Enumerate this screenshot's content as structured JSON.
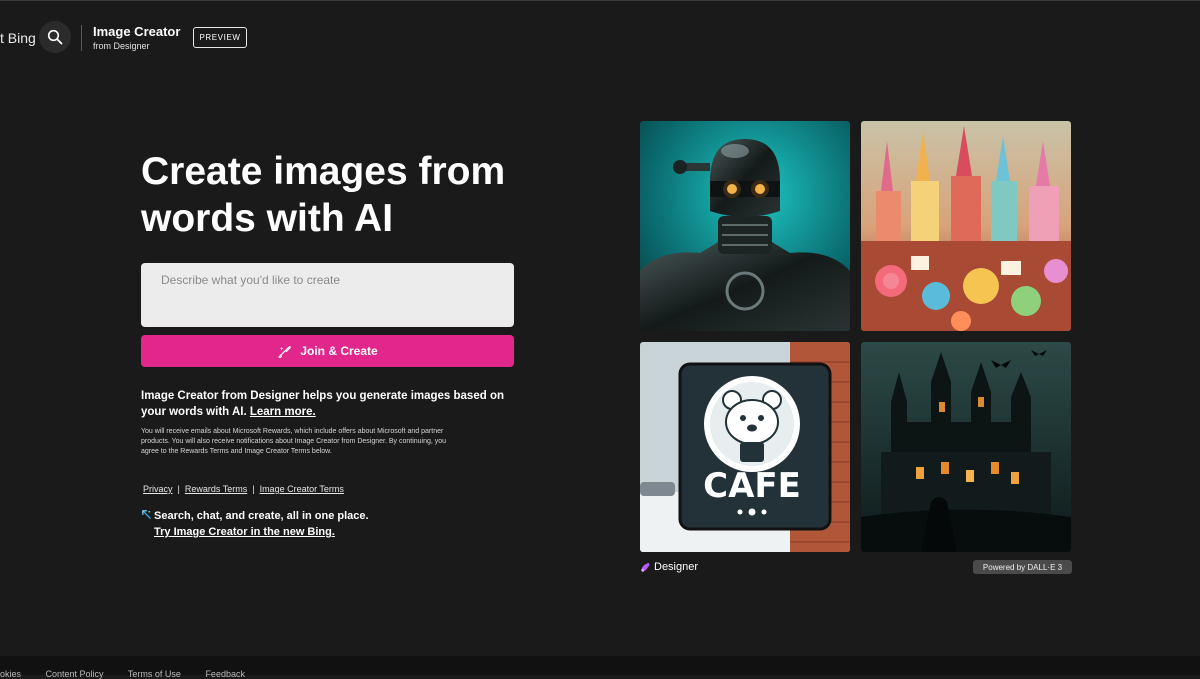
{
  "header": {
    "brand": "t Bing",
    "app_title": "Image Creator",
    "app_subtitle": "from Designer",
    "preview_label": "PREVIEW",
    "search_icon": "search-icon"
  },
  "hero": {
    "heading_line1": "Create images from",
    "heading_line2": "words with AI"
  },
  "prompt": {
    "placeholder": "Describe what you'd like to create",
    "value": ""
  },
  "join_button": {
    "label": "Join & Create",
    "icon": "magic-brush-icon",
    "color": "#e1268c"
  },
  "description": {
    "text": "Image Creator from Designer helps you generate images based on your words with AI.",
    "learn_more": "Learn more."
  },
  "fine_print": "You will receive emails about Microsoft Rewards, which include offers about Microsoft and partner products. You will also receive notifications about Image Creator from Designer. By continuing, you agree to the Rewards Terms and Image Creator Terms below.",
  "legal_links": {
    "privacy": "Privacy",
    "rewards_terms": "Rewards Terms",
    "image_creator_terms": "Image Creator Terms",
    "separator": "|"
  },
  "promo": {
    "text": "Search, chat, and create, all in one place.",
    "link": "Try Image Creator in the new Bing."
  },
  "gallery": {
    "designer_label": "Designer",
    "powered_by": "Powered by DALL·E 3"
  },
  "footer": {
    "items": [
      "okies",
      "Content Policy",
      "Terms of Use",
      "Feedback"
    ]
  },
  "colors": {
    "background": "#1b1a1a",
    "accent": "#e1268c",
    "input_bg": "#ececec"
  }
}
